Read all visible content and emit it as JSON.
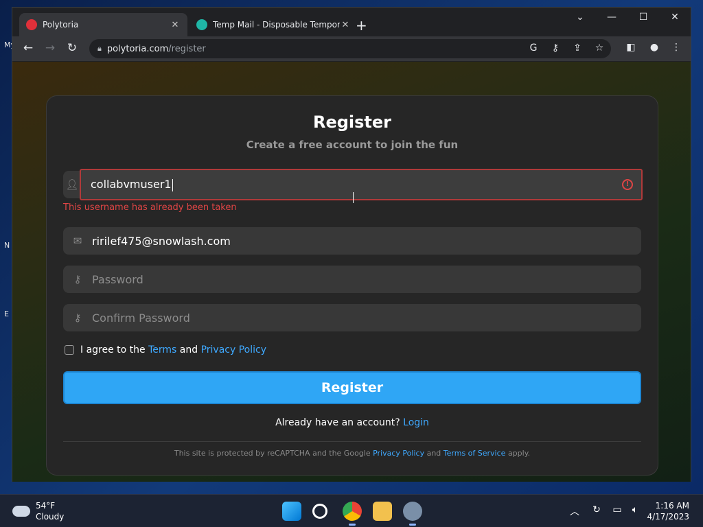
{
  "browser": {
    "tabs": [
      {
        "title": "Polytoria",
        "active": true
      },
      {
        "title": "Temp Mail - Disposable Tempora",
        "active": false
      }
    ],
    "url_host": "polytoria.com",
    "url_path": "/register"
  },
  "desktop_labels": [
    "My",
    "N",
    "E"
  ],
  "form": {
    "title": "Register",
    "subtitle": "Create a free account to join the fun",
    "username_value": "collabvmuser1",
    "username_error": "This username has already been taken",
    "email_value": "ririlef475@snowlash.com",
    "password_placeholder": "Password",
    "confirm_placeholder": "Confirm Password",
    "agree_prefix": "I agree to the",
    "agree_terms": "Terms",
    "agree_and": "and",
    "agree_privacy": "Privacy Policy",
    "register_button": "Register",
    "login_prompt": "Already have an account?",
    "login_link": "Login",
    "recaptcha_prefix": "This site is protected by reCAPTCHA and the Google",
    "recaptcha_privacy": "Privacy Policy",
    "recaptcha_and": "and",
    "recaptcha_terms": "Terms of Service",
    "recaptcha_suffix": "apply."
  },
  "taskbar": {
    "weather_temp": "54°F",
    "weather_desc": "Cloudy",
    "time": "1:16 AM",
    "date": "4/17/2023"
  },
  "colors": {
    "accent": "#2fa6f5",
    "error": "#e04545",
    "link": "#3fa9ff"
  }
}
